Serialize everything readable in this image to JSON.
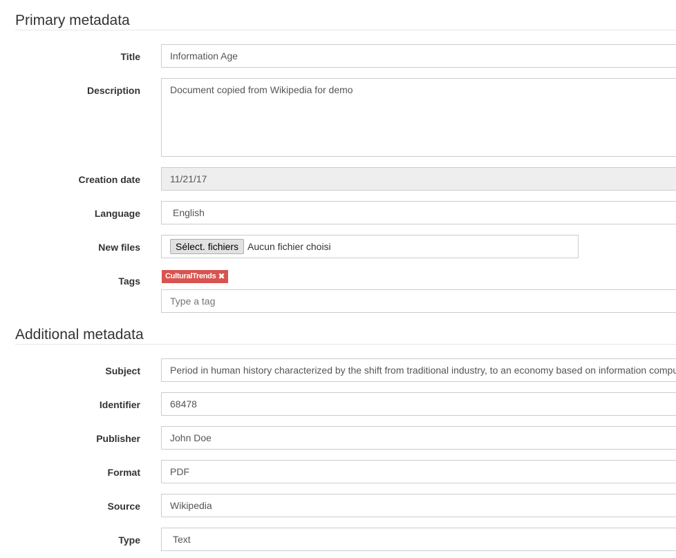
{
  "primary": {
    "title": "Primary metadata",
    "fields": {
      "title": {
        "label": "Title",
        "value": "Information Age"
      },
      "description": {
        "label": "Description",
        "value": "Document copied from Wikipedia for demo"
      },
      "creation_date": {
        "label": "Creation date",
        "value": "11/21/17"
      },
      "language": {
        "label": "Language",
        "value": "English"
      },
      "new_files": {
        "label": "New files",
        "button_label": "Sélect. fichiers",
        "status": "Aucun fichier choisi"
      },
      "tags": {
        "label": "Tags",
        "items": [
          {
            "label": "CulturalTrends",
            "remove_icon": "times-icon"
          }
        ],
        "tag_color": "#d9534f",
        "placeholder": "Type a tag"
      }
    }
  },
  "additional": {
    "title": "Additional metadata",
    "fields": {
      "subject": {
        "label": "Subject",
        "value": "Period in human history characterized by the shift from traditional industry, to an economy based on information computerization"
      },
      "identifier": {
        "label": "Identifier",
        "value": "68478"
      },
      "publisher": {
        "label": "Publisher",
        "value": "John Doe"
      },
      "format": {
        "label": "Format",
        "value": "PDF"
      },
      "source": {
        "label": "Source",
        "value": "Wikipedia"
      },
      "type": {
        "label": "Type",
        "value": "Text"
      }
    }
  }
}
